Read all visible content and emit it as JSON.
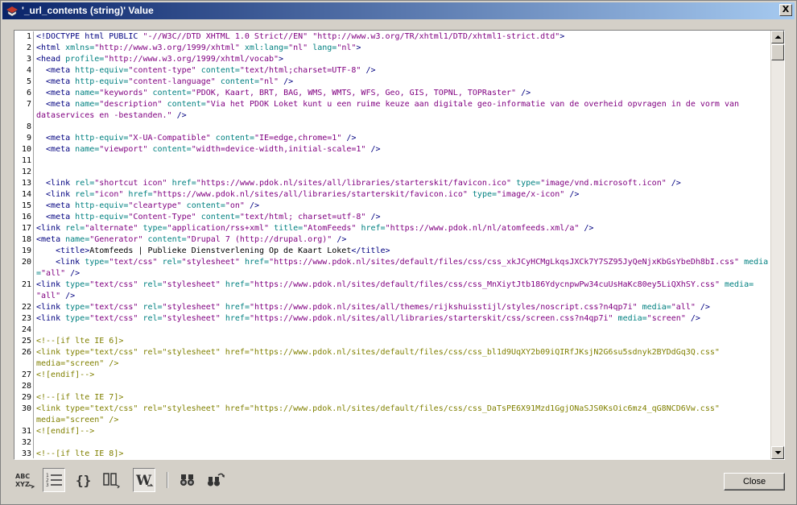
{
  "window": {
    "title": "'_url_contents (string)' Value",
    "close_glyph": "X"
  },
  "toolbar": {
    "buttons": [
      {
        "name": "spellcheck-icon",
        "glyph": "ABC"
      },
      {
        "name": "line-numbers-icon",
        "glyph": "≡"
      },
      {
        "name": "braces-icon",
        "glyph": "{}"
      },
      {
        "name": "columns-icon",
        "glyph": "▯▯"
      },
      {
        "name": "word-wrap-icon",
        "glyph": "W"
      },
      {
        "name": "find-icon",
        "glyph": "binoculars"
      },
      {
        "name": "find-next-icon",
        "glyph": "binoculars-arrow"
      }
    ]
  },
  "close_button": {
    "label": "Close"
  },
  "editor": {
    "lines": [
      {
        "n": "1",
        "t": [
          [
            "tag",
            "<!DOCTYPE html PUBLIC "
          ],
          [
            "val",
            "\"-//W3C//DTD XHTML 1.0 Strict//EN\""
          ],
          [
            "tag",
            " "
          ],
          [
            "val",
            "\"http://www.w3.org/TR/xhtml1/DTD/xhtml1-strict.dtd\""
          ],
          [
            "tag",
            ">"
          ]
        ]
      },
      {
        "n": "2",
        "t": [
          [
            "tag",
            "<html "
          ],
          [
            "attr",
            "xmlns="
          ],
          [
            "val",
            "\"http://www.w3.org/1999/xhtml\""
          ],
          [
            "tag",
            " "
          ],
          [
            "attr",
            "xml:lang="
          ],
          [
            "val",
            "\"nl\""
          ],
          [
            "tag",
            " "
          ],
          [
            "attr",
            "lang="
          ],
          [
            "val",
            "\"nl\""
          ],
          [
            "tag",
            ">"
          ]
        ]
      },
      {
        "n": "3",
        "t": [
          [
            "tag",
            "<head "
          ],
          [
            "attr",
            "profile="
          ],
          [
            "val",
            "\"http://www.w3.org/1999/xhtml/vocab\""
          ],
          [
            "tag",
            ">"
          ]
        ]
      },
      {
        "n": "4",
        "t": [
          [
            "tag",
            "  <meta "
          ],
          [
            "attr",
            "http-equiv="
          ],
          [
            "val",
            "\"content-type\""
          ],
          [
            "tag",
            " "
          ],
          [
            "attr",
            "content="
          ],
          [
            "val",
            "\"text/html;charset=UTF-8\""
          ],
          [
            "tag",
            " />"
          ]
        ]
      },
      {
        "n": "5",
        "t": [
          [
            "tag",
            "  <meta "
          ],
          [
            "attr",
            "http-equiv="
          ],
          [
            "val",
            "\"content-language\""
          ],
          [
            "tag",
            " "
          ],
          [
            "attr",
            "content="
          ],
          [
            "val",
            "\"nl\""
          ],
          [
            "tag",
            " />"
          ]
        ]
      },
      {
        "n": "6",
        "t": [
          [
            "tag",
            "  <meta "
          ],
          [
            "attr",
            "name="
          ],
          [
            "val",
            "\"keywords\""
          ],
          [
            "tag",
            " "
          ],
          [
            "attr",
            "content="
          ],
          [
            "val",
            "\"PDOK, Kaart, BRT, BAG, WMS, WMTS, WFS, Geo, GIS, TOPNL, TOPRaster\""
          ],
          [
            "tag",
            " />"
          ]
        ]
      },
      {
        "n": "7",
        "t": [
          [
            "tag",
            "  <meta "
          ],
          [
            "attr",
            "name="
          ],
          [
            "val",
            "\"description\""
          ],
          [
            "tag",
            " "
          ],
          [
            "attr",
            "content="
          ],
          [
            "val",
            "\"Via het PDOK Loket kunt u een ruime keuze aan digitale geo-informatie van de overheid opvragen in de vorm van"
          ]
        ]
      },
      {
        "n": "",
        "t": [
          [
            "val",
            "dataservices en -bestanden.\""
          ],
          [
            "tag",
            " />"
          ]
        ]
      },
      {
        "n": "8",
        "t": []
      },
      {
        "n": "9",
        "t": [
          [
            "tag",
            "  <meta "
          ],
          [
            "attr",
            "http-equiv="
          ],
          [
            "val",
            "\"X-UA-Compatible\""
          ],
          [
            "tag",
            " "
          ],
          [
            "attr",
            "content="
          ],
          [
            "val",
            "\"IE=edge,chrome=1\""
          ],
          [
            "tag",
            " />"
          ]
        ]
      },
      {
        "n": "10",
        "t": [
          [
            "tag",
            "  <meta "
          ],
          [
            "attr",
            "name="
          ],
          [
            "val",
            "\"viewport\""
          ],
          [
            "tag",
            " "
          ],
          [
            "attr",
            "content="
          ],
          [
            "val",
            "\"width=device-width,initial-scale=1\""
          ],
          [
            "tag",
            " />"
          ]
        ]
      },
      {
        "n": "11",
        "t": []
      },
      {
        "n": "12",
        "t": []
      },
      {
        "n": "13",
        "t": [
          [
            "tag",
            "  <link "
          ],
          [
            "attr",
            "rel="
          ],
          [
            "val",
            "\"shortcut icon\""
          ],
          [
            "tag",
            " "
          ],
          [
            "attr",
            "href="
          ],
          [
            "val",
            "\"https://www.pdok.nl/sites/all/libraries/starterskit/favicon.ico\""
          ],
          [
            "tag",
            " "
          ],
          [
            "attr",
            "type="
          ],
          [
            "val",
            "\"image/vnd.microsoft.icon\""
          ],
          [
            "tag",
            " />"
          ]
        ]
      },
      {
        "n": "14",
        "t": [
          [
            "tag",
            "  <link "
          ],
          [
            "attr",
            "rel="
          ],
          [
            "val",
            "\"icon\""
          ],
          [
            "tag",
            " "
          ],
          [
            "attr",
            "href="
          ],
          [
            "val",
            "\"https://www.pdok.nl/sites/all/libraries/starterskit/favicon.ico\""
          ],
          [
            "tag",
            " "
          ],
          [
            "attr",
            "type="
          ],
          [
            "val",
            "\"image/x-icon\""
          ],
          [
            "tag",
            " />"
          ]
        ]
      },
      {
        "n": "15",
        "t": [
          [
            "tag",
            "  <meta "
          ],
          [
            "attr",
            "http-equiv="
          ],
          [
            "val",
            "\"cleartype\""
          ],
          [
            "tag",
            " "
          ],
          [
            "attr",
            "content="
          ],
          [
            "val",
            "\"on\""
          ],
          [
            "tag",
            " />"
          ]
        ]
      },
      {
        "n": "16",
        "t": [
          [
            "tag",
            "  <meta "
          ],
          [
            "attr",
            "http-equiv="
          ],
          [
            "val",
            "\"Content-Type\""
          ],
          [
            "tag",
            " "
          ],
          [
            "attr",
            "content="
          ],
          [
            "val",
            "\"text/html; charset=utf-8\""
          ],
          [
            "tag",
            " />"
          ]
        ]
      },
      {
        "n": "17",
        "t": [
          [
            "tag",
            "<link "
          ],
          [
            "attr",
            "rel="
          ],
          [
            "val",
            "\"alternate\""
          ],
          [
            "tag",
            " "
          ],
          [
            "attr",
            "type="
          ],
          [
            "val",
            "\"application/rss+xml\""
          ],
          [
            "tag",
            " "
          ],
          [
            "attr",
            "title="
          ],
          [
            "val",
            "\"AtomFeeds\""
          ],
          [
            "tag",
            " "
          ],
          [
            "attr",
            "href="
          ],
          [
            "val",
            "\"https://www.pdok.nl/nl/atomfeeds.xml/a\""
          ],
          [
            "tag",
            " />"
          ]
        ]
      },
      {
        "n": "18",
        "t": [
          [
            "tag",
            "<meta "
          ],
          [
            "attr",
            "name="
          ],
          [
            "val",
            "\"Generator\""
          ],
          [
            "tag",
            " "
          ],
          [
            "attr",
            "content="
          ],
          [
            "val",
            "\"Drupal 7 (http://drupal.org)\""
          ],
          [
            "tag",
            " />"
          ]
        ]
      },
      {
        "n": "19",
        "t": [
          [
            "tag",
            "    <title>"
          ],
          [
            "text",
            "Atomfeeds | Publieke Dienstverlening Op de Kaart Loket"
          ],
          [
            "tag",
            "</title>"
          ]
        ]
      },
      {
        "n": "20",
        "t": [
          [
            "tag",
            "    <link "
          ],
          [
            "attr",
            "type="
          ],
          [
            "val",
            "\"text/css\""
          ],
          [
            "tag",
            " "
          ],
          [
            "attr",
            "rel="
          ],
          [
            "val",
            "\"stylesheet\""
          ],
          [
            "tag",
            " "
          ],
          [
            "attr",
            "href="
          ],
          [
            "val",
            "\"https://www.pdok.nl/sites/default/files/css/css_xkJCyHCMgLkqsJXCk7Y7SZ95JyQeNjxKbGsYbeDh8bI.css\""
          ],
          [
            "tag",
            " "
          ],
          [
            "attr",
            "media"
          ]
        ]
      },
      {
        "n": "",
        "t": [
          [
            "attr",
            "="
          ],
          [
            "val",
            "\"all\""
          ],
          [
            "tag",
            " />"
          ]
        ]
      },
      {
        "n": "21",
        "t": [
          [
            "tag",
            "<link "
          ],
          [
            "attr",
            "type="
          ],
          [
            "val",
            "\"text/css\""
          ],
          [
            "tag",
            " "
          ],
          [
            "attr",
            "rel="
          ],
          [
            "val",
            "\"stylesheet\""
          ],
          [
            "tag",
            " "
          ],
          [
            "attr",
            "href="
          ],
          [
            "val",
            "\"https://www.pdok.nl/sites/default/files/css/css_MnXiytJtb186YdycnpwPw34cuUsHaKc80ey5LiQXhSY.css\""
          ],
          [
            "tag",
            " "
          ],
          [
            "attr",
            "media="
          ]
        ]
      },
      {
        "n": "",
        "t": [
          [
            "val",
            "\"all\""
          ],
          [
            "tag",
            " />"
          ]
        ]
      },
      {
        "n": "22",
        "t": [
          [
            "tag",
            "<link "
          ],
          [
            "attr",
            "type="
          ],
          [
            "val",
            "\"text/css\""
          ],
          [
            "tag",
            " "
          ],
          [
            "attr",
            "rel="
          ],
          [
            "val",
            "\"stylesheet\""
          ],
          [
            "tag",
            " "
          ],
          [
            "attr",
            "href="
          ],
          [
            "val",
            "\"https://www.pdok.nl/sites/all/themes/rijkshuisstijl/styles/noscript.css?n4qp7i\""
          ],
          [
            "tag",
            " "
          ],
          [
            "attr",
            "media="
          ],
          [
            "val",
            "\"all\""
          ],
          [
            "tag",
            " />"
          ]
        ]
      },
      {
        "n": "23",
        "t": [
          [
            "tag",
            "<link "
          ],
          [
            "attr",
            "type="
          ],
          [
            "val",
            "\"text/css\""
          ],
          [
            "tag",
            " "
          ],
          [
            "attr",
            "rel="
          ],
          [
            "val",
            "\"stylesheet\""
          ],
          [
            "tag",
            " "
          ],
          [
            "attr",
            "href="
          ],
          [
            "val",
            "\"https://www.pdok.nl/sites/all/libraries/starterskit/css/screen.css?n4qp7i\""
          ],
          [
            "tag",
            " "
          ],
          [
            "attr",
            "media="
          ],
          [
            "val",
            "\"screen\""
          ],
          [
            "tag",
            " />"
          ]
        ]
      },
      {
        "n": "24",
        "t": []
      },
      {
        "n": "25",
        "t": [
          [
            "com",
            "<!--[if lte IE 6]>"
          ]
        ]
      },
      {
        "n": "26",
        "t": [
          [
            "com",
            "<link type=\"text/css\" rel=\"stylesheet\" href=\"https://www.pdok.nl/sites/default/files/css/css_bl1d9UqXY2b09iQIRfJKsjN2G6su5sdnyk2BYDdGq3Q.css\""
          ]
        ]
      },
      {
        "n": "",
        "t": [
          [
            "com",
            "media=\"screen\" />"
          ]
        ]
      },
      {
        "n": "27",
        "t": [
          [
            "com",
            "<![endif]-->"
          ]
        ]
      },
      {
        "n": "28",
        "t": []
      },
      {
        "n": "29",
        "t": [
          [
            "com",
            "<!--[if lte IE 7]>"
          ]
        ]
      },
      {
        "n": "30",
        "t": [
          [
            "com",
            "<link type=\"text/css\" rel=\"stylesheet\" href=\"https://www.pdok.nl/sites/default/files/css/css_DaTsPE6X91Mzd1GgjONaSJS0KsOic6mz4_qG8NCD6Vw.css\""
          ]
        ]
      },
      {
        "n": "",
        "t": [
          [
            "com",
            "media=\"screen\" />"
          ]
        ]
      },
      {
        "n": "31",
        "t": [
          [
            "com",
            "<![endif]-->"
          ]
        ]
      },
      {
        "n": "32",
        "t": []
      },
      {
        "n": "33",
        "t": [
          [
            "com",
            "<!--[if lte IE 8]>"
          ]
        ]
      }
    ]
  }
}
